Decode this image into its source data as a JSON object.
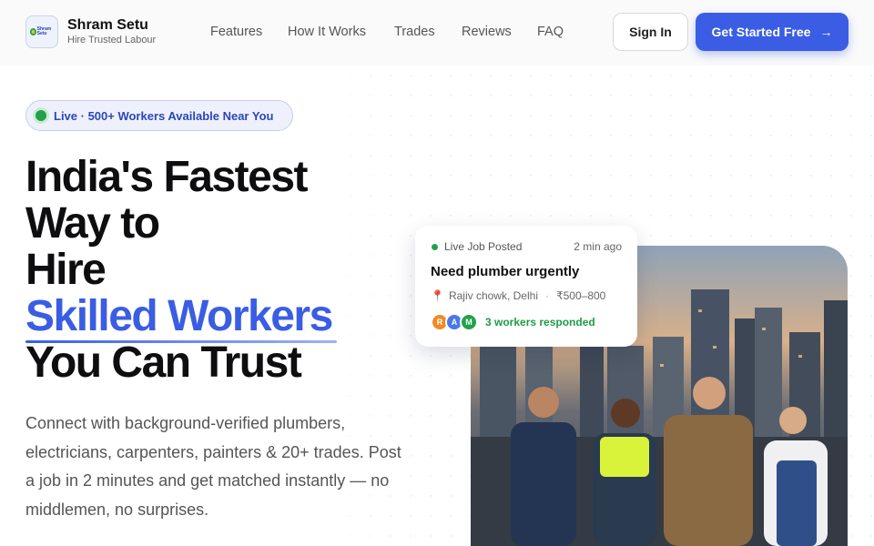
{
  "brand": {
    "name": "Shram Setu",
    "tagline": "Hire Trusted Labour",
    "logo_text": "Shram Setu"
  },
  "nav": {
    "items": [
      "Features",
      "How It Works",
      "Trades",
      "Reviews",
      "FAQ"
    ],
    "signin_label": "Sign In",
    "cta_label": "Get Started Free"
  },
  "hero": {
    "live_badge": "Live · 500+ Workers Available Near You",
    "headline": {
      "line1": "India's Fastest",
      "line2": "Way to",
      "line3": "Hire",
      "line4_highlight": "Skilled Workers",
      "line5": "You Can Trust"
    },
    "description": "Connect with background-verified plumbers, electricians, carpenters, painters & 20+ trades. Post a job in 2 minutes and get matched instantly — no middlemen, no surprises."
  },
  "job_card": {
    "status": "Live Job Posted",
    "time": "2 min ago",
    "title": "Need plumber urgently",
    "location": "Rajiv chowk, Delhi",
    "budget": "₹500–800",
    "avatars": [
      {
        "initial": "R",
        "color": "#f08a24"
      },
      {
        "initial": "A",
        "color": "#4a78e8"
      },
      {
        "initial": "M",
        "color": "#22a14a"
      }
    ],
    "responded": "3 workers responded"
  },
  "colors": {
    "accent": "#3a5de4",
    "live_green": "#22a14a",
    "text_dark": "#0e0e10"
  },
  "icons": {
    "cta_arrow": "arrow-right-icon",
    "live": "live-dot-icon",
    "location": "map-pin-icon"
  }
}
